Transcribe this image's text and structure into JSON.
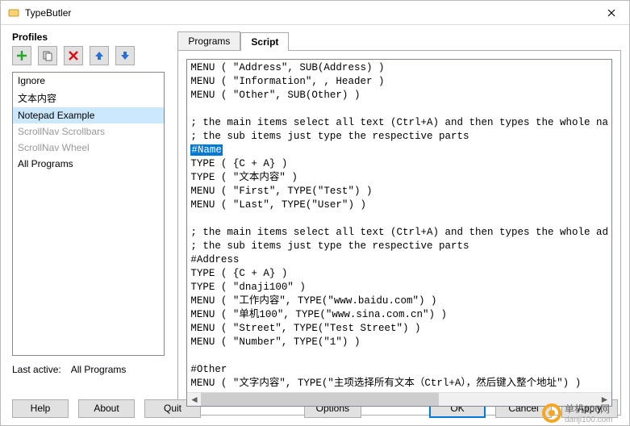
{
  "window": {
    "title": "TypeButler"
  },
  "profiles": {
    "heading": "Profiles",
    "items": [
      {
        "label": "Ignore",
        "state": "normal"
      },
      {
        "label": "文本内容",
        "state": "normal"
      },
      {
        "label": "Notepad Example",
        "state": "selected"
      },
      {
        "label": "ScrollNav Scrollbars",
        "state": "disabled"
      },
      {
        "label": "ScrollNav Wheel",
        "state": "disabled"
      },
      {
        "label": "All Programs",
        "state": "normal"
      }
    ],
    "last_active_label": "Last active:",
    "last_active_value": "All Programs"
  },
  "tabs": {
    "programs": "Programs",
    "script": "Script"
  },
  "script": {
    "lines": [
      "MENU ( \"Address\", SUB(Address) )",
      "MENU ( \"Information\", , Header )",
      "MENU ( \"Other\", SUB(Other) )",
      "",
      "; the main items select all text (Ctrl+A) and then types the whole na",
      "; the sub items just type the respective parts"
    ],
    "highlighted": "#Name",
    "lines_after": [
      "TYPE ( {C + A} )",
      "TYPE ( \"文本内容\" )",
      "MENU ( \"First\", TYPE(\"Test\") )",
      "MENU ( \"Last\", TYPE(\"User\") )",
      "",
      "; the main items select all text (Ctrl+A) and then types the whole ad",
      "; the sub items just type the respective parts",
      "#Address",
      "TYPE ( {C + A} )",
      "TYPE ( \"dnaji100\" )",
      "MENU ( \"工作内容\", TYPE(\"www.baidu.com\") )",
      "MENU ( \"单机100\", TYPE(\"www.sina.com.cn\") )",
      "MENU ( \"Street\", TYPE(\"Test Street\") )",
      "MENU ( \"Number\", TYPE(\"1\") )",
      "",
      "#Other",
      "MENU ( \"文字内容\", TYPE(\"主项选择所有文本（Ctrl+A），然后键入整个地址\") )"
    ]
  },
  "buttons": {
    "help": "Help",
    "about": "About",
    "quit": "Quit",
    "options": "Options",
    "ok": "OK",
    "cancel": "Cancel",
    "apply": "Apply"
  },
  "watermark": {
    "text": "单机100网",
    "url": "danji100.com"
  }
}
